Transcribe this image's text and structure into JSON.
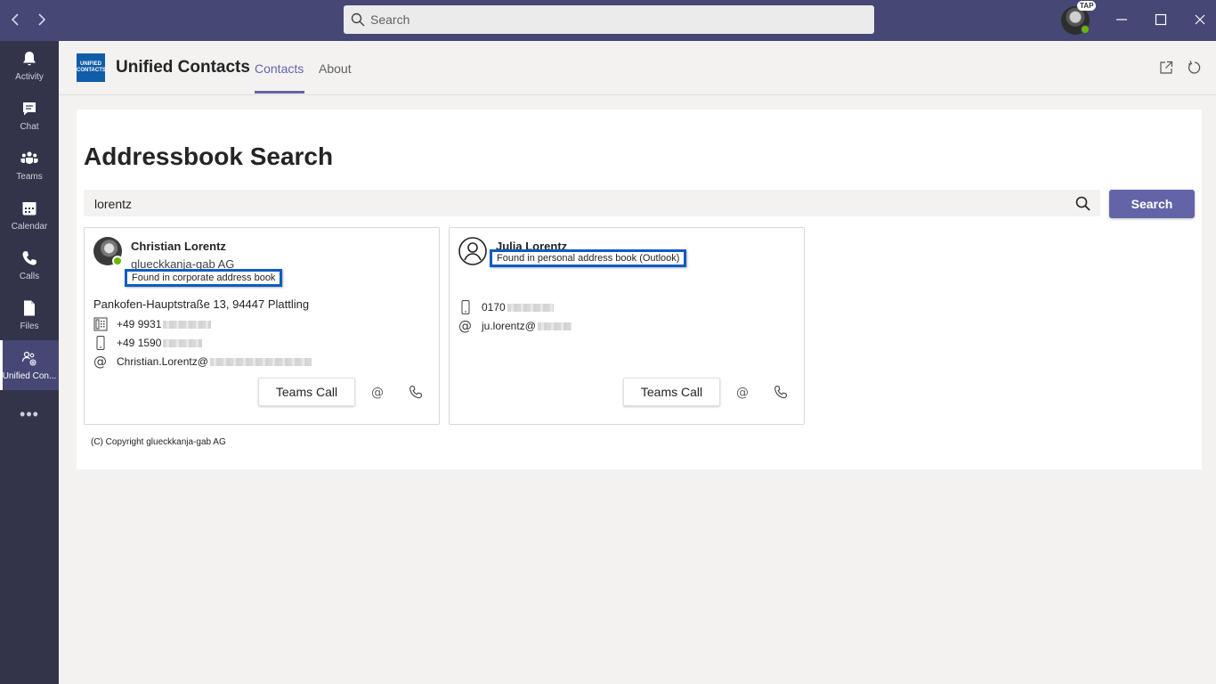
{
  "titlebar": {
    "search_placeholder": "Search",
    "avatar_badge": "TAP"
  },
  "rail": {
    "items": [
      {
        "label": "Activity",
        "icon": "bell-icon"
      },
      {
        "label": "Chat",
        "icon": "chat-icon"
      },
      {
        "label": "Teams",
        "icon": "teams-icon"
      },
      {
        "label": "Calendar",
        "icon": "calendar-icon"
      },
      {
        "label": "Calls",
        "icon": "phone-icon"
      },
      {
        "label": "Files",
        "icon": "file-icon"
      },
      {
        "label": "Unified Con...",
        "icon": "unified-contacts-icon"
      }
    ],
    "more": "•••"
  },
  "app": {
    "logo_text": "UNIFIED CONTACTS",
    "title": "Unified Contacts",
    "tabs": [
      "Contacts",
      "About"
    ]
  },
  "page": {
    "title": "Addressbook Search",
    "query": "lorentz",
    "search_button": "Search",
    "copyright": "(C) Copyright glueckkanja-gab AG"
  },
  "contacts": [
    {
      "name": "Christian Lorentz",
      "company": "glueckkanja-gab AG",
      "source": "Found in corporate address book",
      "address": "Pankofen-Hauptstraße 13, 94447 Plattling",
      "phone_office": "+49 9931",
      "phone_mobile": "+49 1590",
      "email": "Christian.Lorentz@",
      "presence": "available",
      "call_button": "Teams Call"
    },
    {
      "name": "Julia Lorentz",
      "source": "Found in personal address book (Outlook)",
      "phone_mobile": "0170",
      "email": "ju.lorentz@",
      "call_button": "Teams Call"
    }
  ],
  "colors": {
    "titlebar": "#464775",
    "rail": "#33344a",
    "accent": "#6264a7",
    "highlight_box": "#0f5cc0",
    "presence_available": "#6bb700"
  }
}
